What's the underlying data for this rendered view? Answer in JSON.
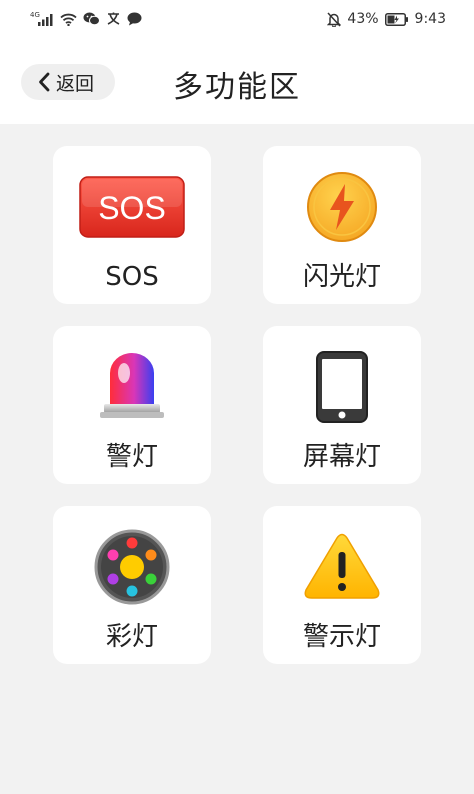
{
  "status_bar": {
    "signal_tag": "4G",
    "battery_percent": "43%",
    "time": "9:43"
  },
  "nav": {
    "back_label": "返回",
    "title": "多功能区"
  },
  "tiles": [
    {
      "label": "SOS",
      "icon": "sos-badge-icon",
      "icon_text": "SOS"
    },
    {
      "label": "闪光灯",
      "icon": "flash-lightning-icon"
    },
    {
      "label": "警灯",
      "icon": "police-siren-icon"
    },
    {
      "label": "屏幕灯",
      "icon": "phone-screen-icon"
    },
    {
      "label": "彩灯",
      "icon": "color-light-icon"
    },
    {
      "label": "警示灯",
      "icon": "warning-triangle-icon"
    }
  ],
  "colors": {
    "background": "#f2f2f2",
    "card": "#ffffff",
    "sos_red": "#ee3b30",
    "flash_yellow": "#f7b731",
    "warning_yellow": "#ffcc22"
  }
}
